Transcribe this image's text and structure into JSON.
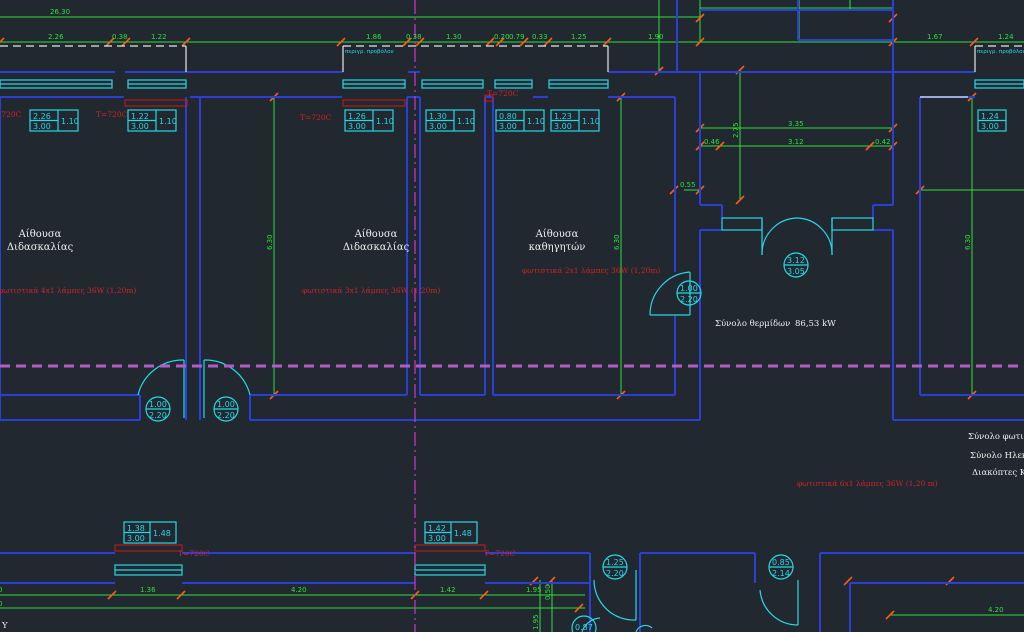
{
  "dimensions": {
    "top_total": "26.30",
    "row": [
      "2.26",
      "0.38",
      "1.22",
      "1.86",
      "0.38",
      "1.30",
      "0.20",
      "0.79",
      "0.33",
      "1.25",
      "1.90",
      "1.67",
      "1.24"
    ],
    "core_width": "3.35",
    "core_inner": "3.12",
    "core_side_left": "0.46",
    "core_side_right": "0.42",
    "core_height": "2.75",
    "door_gap": "0.55",
    "room_height": "6.30",
    "bottom_row": [
      "1.36",
      "4.20",
      "1.42",
      "1.95",
      "0.50",
      "4.20"
    ],
    "bottom_vertical": [
      "1.95",
      "0.50"
    ],
    "left_edge": "0",
    "left_edge2": "0"
  },
  "labels": {
    "facade_note": "περιγρ. προβόλου",
    "temp": "T=720C",
    "rooms": [
      {
        "line1": "Αίθουσα",
        "line2": "Διδασκαλίας"
      },
      {
        "line1": "Αίθουσα",
        "line2": "Διδασκαλίας"
      },
      {
        "line1": "Αίθουσα",
        "line2": "καθηγητών"
      }
    ],
    "lights": [
      "φωτιστικά 4x1 λάμπες 36W (1,20m)",
      "φωτιστικά 3x1 λάμπες 36W (1,20m)",
      "φωτιστικά 2x1 λάμπες 36W (1,20m)",
      "φωτιστικά 6x1 λάμπες 36W (1,20 m)"
    ],
    "total_heating": "Σύνολο θερμίδων",
    "total_heating_value": "86,53 kW",
    "right_notes": [
      "Σύνολο φωτι",
      "Σύνολο Ηλεκτ",
      "Διακόπτες ΚΙ"
    ],
    "y_mark": "Y"
  },
  "window_tags": [
    {
      "w": "2.26",
      "h": "3.00",
      "s": "1.10"
    },
    {
      "w": "1.22",
      "h": "3.00",
      "s": "1.10"
    },
    {
      "w": "1.26",
      "h": "3.00",
      "s": "1.10"
    },
    {
      "w": "1.30",
      "h": "3.00",
      "s": "1.10"
    },
    {
      "w": "0.80",
      "h": "3.00",
      "s": "1.10"
    },
    {
      "w": "1.23",
      "h": "3.00",
      "s": "1.10"
    },
    {
      "w": "1.24",
      "h": "3.00",
      "s": ""
    },
    {
      "w": "1.38",
      "h": "3.00",
      "s": "1.48"
    },
    {
      "w": "1.42",
      "h": "3.00",
      "s": "1.48"
    }
  ],
  "door_tags": [
    {
      "w": "1.00",
      "h": "2.20"
    },
    {
      "w": "1.00",
      "h": "2.20"
    },
    {
      "w": "1.00",
      "h": "2.20"
    },
    {
      "w": "3.12",
      "h": "3.05"
    },
    {
      "w": "1.25",
      "h": "2.20"
    },
    {
      "w": "0.85",
      "h": "2.14"
    },
    {
      "w": "0.87",
      "h": ""
    }
  ],
  "colors": {
    "background": "#212830",
    "walls": "#2a3fd6",
    "dimensions": "#2ee03a",
    "openings": "#27d8e6",
    "annotations": "#d02424",
    "dim_ticks": "#ff5a1a",
    "axis": "#d232d2"
  }
}
